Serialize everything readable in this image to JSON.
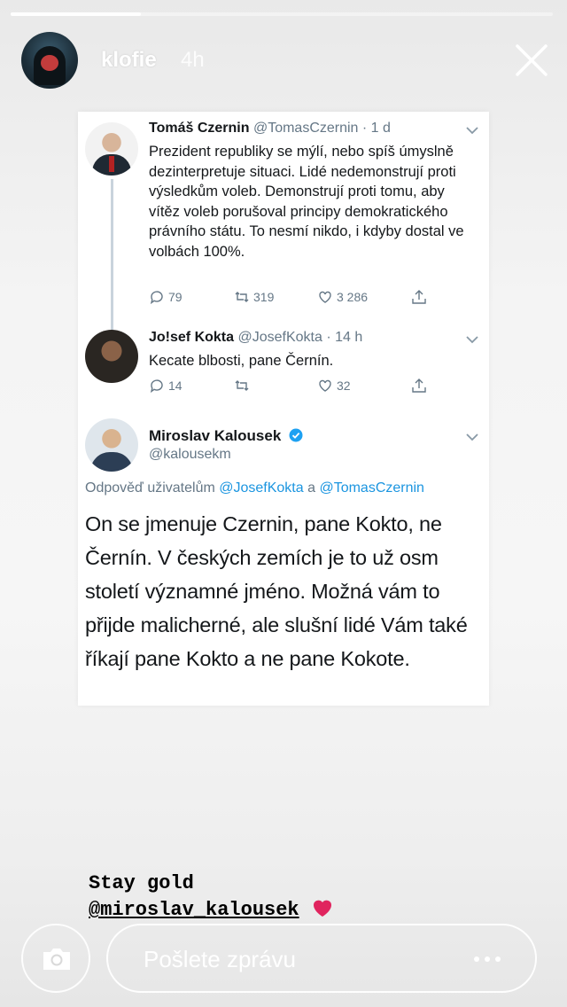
{
  "story": {
    "progress": 0.24,
    "username": "klofie",
    "time": "4h"
  },
  "tweets": [
    {
      "name": "Tomáš Czernin",
      "handle": "@TomasCzernin · 1 d",
      "text": "Prezident republiky se mýlí, nebo spíš úmyslně dezinterpretuje situaci. Lidé nedemonstrují proti výsledkům voleb. Demonstrují proti tomu, aby vítěz voleb porušoval principy demokratického právního státu. To nesmí nikdo, i kdyby dostal ve volbách 100%.",
      "replies": "79",
      "retweets": "319",
      "likes": "3 286"
    },
    {
      "name": "Jo!sef Kokta",
      "handle": "@JosefKokta · 14 h",
      "text": "Kecate blbosti, pane Černín.",
      "replies": "14",
      "retweets": "",
      "likes": "32"
    }
  ],
  "main_tweet": {
    "name": "Miroslav Kalousek",
    "handle": "@kalousekm",
    "reply_prefix": "Odpověď uživatelům ",
    "reply_mention_1": "@JosefKokta",
    "reply_and": " a ",
    "reply_mention_2": "@TomasCzernin",
    "text": "On se jmenuje Czernin, pane Kokto, ne Černín. V českých zemích je to už osm století významné jméno. Možná vám to přijde malicherné, ale slušní lidé Vám také říkají pane Kokto a ne pane Kokote."
  },
  "caption": {
    "line1": "Stay gold",
    "mention": "@miroslav_kalousek",
    "emoji": "red-heart"
  },
  "message_bar": {
    "placeholder": "Pošlete zprávu"
  },
  "colors": {
    "handle_gray": "#657786",
    "link_blue": "#1b95e0",
    "verified_blue": "#1da1f2",
    "heart_red": "#e0245e"
  }
}
